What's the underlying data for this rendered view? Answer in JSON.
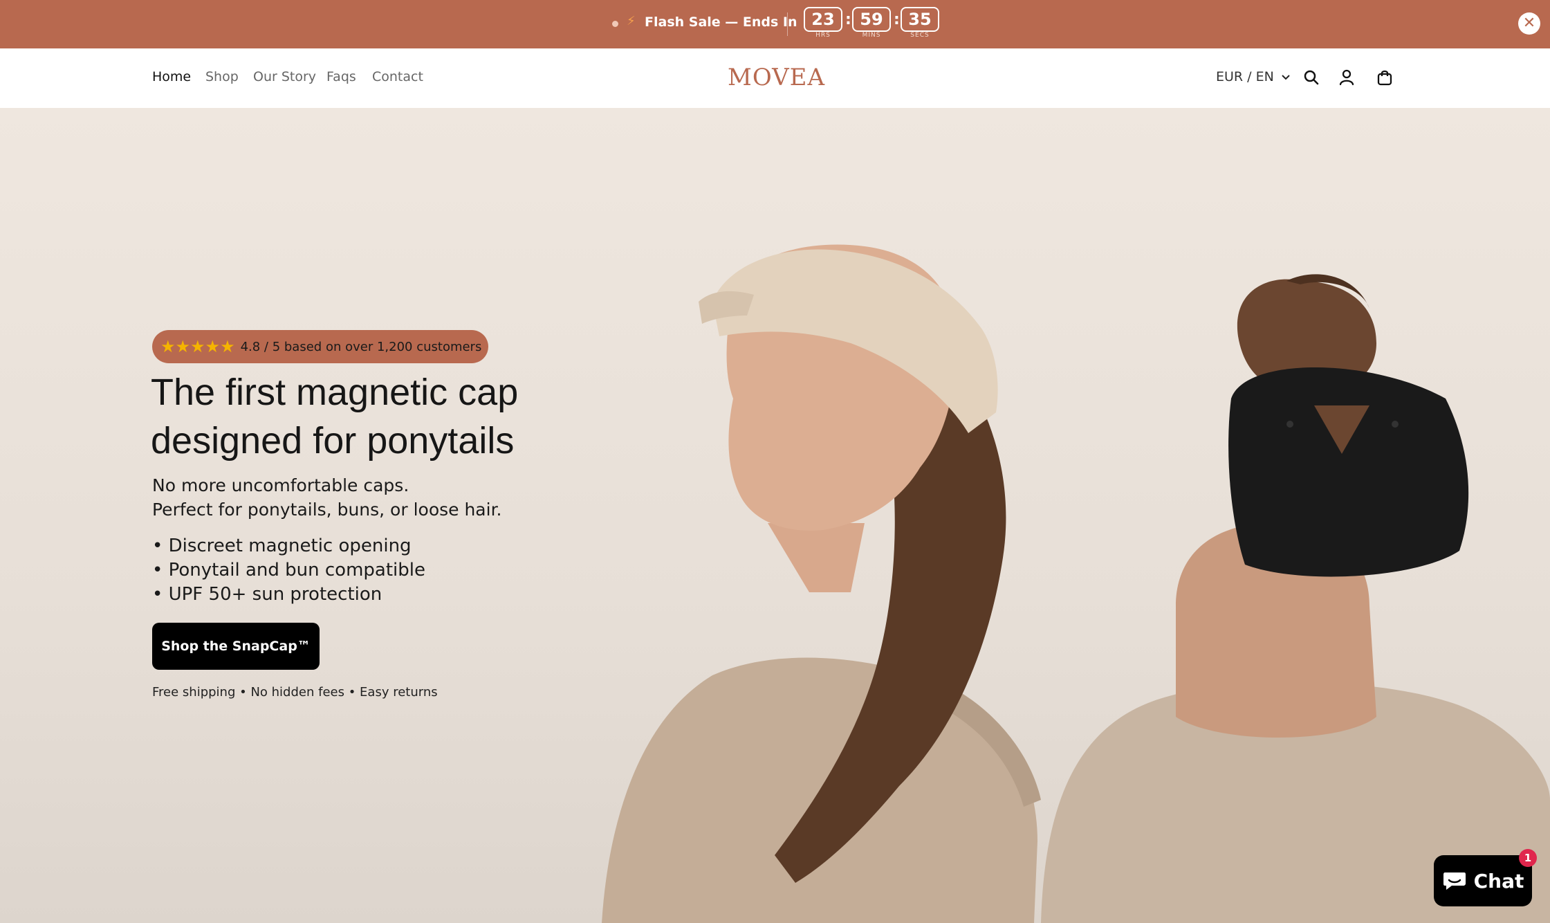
{
  "announcement": {
    "flash_text": "Flash Sale — Ends In",
    "timer": {
      "hours": "23",
      "hours_label": "HRS",
      "minutes": "59",
      "minutes_label": "MINS",
      "seconds": "35",
      "seconds_label": "SECS"
    },
    "close_label": "✕"
  },
  "header": {
    "nav": [
      "Home",
      "Shop",
      "Our Story",
      "Faqs",
      "Contact"
    ],
    "logo": "MOVEA",
    "locale": "EUR / EN"
  },
  "hero": {
    "rating": {
      "stars": "★★★★★",
      "text": "4.8 / 5 based on over 1,200 customers"
    },
    "headline_line1": "The first magnetic cap",
    "headline_line2": "designed for ponytails",
    "subline_1": "No more uncomfortable caps.",
    "subline_2": "Perfect for ponytails, buns, or loose hair.",
    "bullets": [
      "• Discreet magnetic opening",
      "• Ponytail and bun compatible",
      "• UPF 50+ sun protection"
    ],
    "cta_label": "Shop the SnapCap™",
    "perks": "Free shipping • No hidden fees • Easy returns"
  },
  "chat": {
    "label": "Chat",
    "badge": "1"
  },
  "colors": {
    "brand": "#b8694f",
    "announcement_bg": "#b8694f",
    "cta_bg": "#000000",
    "star": "#f5b400",
    "chat_badge": "#e0264d"
  },
  "icons": {
    "search": "search-icon",
    "account": "user-icon",
    "cart": "bag-icon",
    "chat": "chat-bubble-icon",
    "close": "close-icon",
    "sale": "lightning-icon"
  }
}
